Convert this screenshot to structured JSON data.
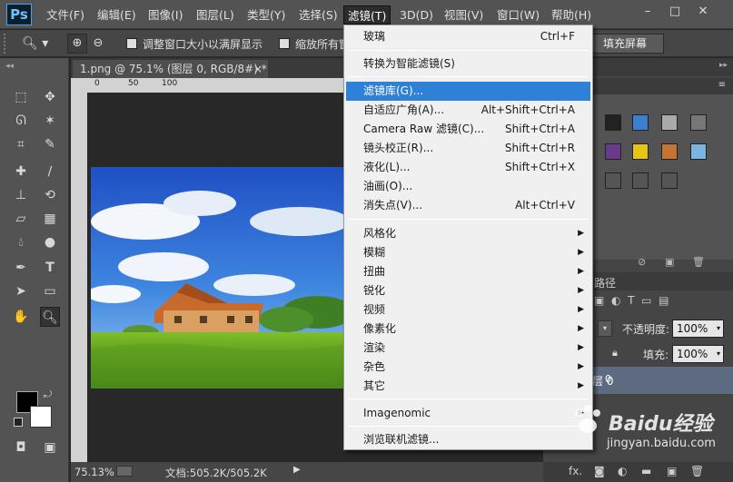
{
  "app": {
    "logo": "Ps"
  },
  "menubar": {
    "items": [
      "文件(F)",
      "编辑(E)",
      "图像(I)",
      "图层(L)",
      "类型(Y)",
      "选择(S)",
      "滤镜(T)",
      "3D(D)",
      "视图(V)",
      "窗口(W)",
      "帮助(H)"
    ],
    "active": "滤镜(T)",
    "window_buttons": {
      "minimize": "–",
      "restore": "□",
      "close": "✕"
    }
  },
  "options_bar": {
    "resize_windows_label": "调整窗口大小以满屏显示",
    "zoom_all_label": "缩放所有窗",
    "fill_screen_button": "填充屏幕"
  },
  "document": {
    "tab_title": "1.png @ 75.1% (图层 0, RGB/8#) *",
    "ruler_marks": [
      "0",
      "50",
      "100"
    ],
    "zoom": "75.13%",
    "doc_info": "文档:505.2K/505.2K"
  },
  "layers_panel": {
    "opacity_label": "不透明度:",
    "opacity_value": "100%",
    "fill_label": "填充:",
    "fill_value": "100%",
    "layer_name": "层 0",
    "layer_value": "0",
    "paths_tab": "路径"
  },
  "filter_menu": {
    "items": [
      {
        "label": "玻璃",
        "shortcut": "Ctrl+F"
      },
      {
        "label": "转换为智能滤镜(S)"
      },
      {
        "label": "滤镜库(G)...",
        "highlighted": true
      },
      {
        "label": "自适应广角(A)...",
        "shortcut": "Alt+Shift+Ctrl+A"
      },
      {
        "label": "Camera Raw 滤镜(C)...",
        "shortcut": "Shift+Ctrl+A"
      },
      {
        "label": "镜头校正(R)...",
        "shortcut": "Shift+Ctrl+R"
      },
      {
        "label": "液化(L)...",
        "shortcut": "Shift+Ctrl+X"
      },
      {
        "label": "油画(O)..."
      },
      {
        "label": "消失点(V)...",
        "shortcut": "Alt+Ctrl+V"
      },
      {
        "label": "风格化"
      },
      {
        "label": "模糊"
      },
      {
        "label": "扭曲"
      },
      {
        "label": "锐化"
      },
      {
        "label": "视频"
      },
      {
        "label": "像素化"
      },
      {
        "label": "渲染"
      },
      {
        "label": "杂色"
      },
      {
        "label": "其它"
      },
      {
        "label": "Imagenomic"
      },
      {
        "label": "浏览联机滤镜..."
      }
    ]
  },
  "watermark": {
    "brand": "Baidu经验",
    "url": "jingyan.baidu.com"
  },
  "colors": {
    "menu_highlight": "#2f80d7",
    "ui_dark": "#535353",
    "foreground": "#000000",
    "background": "#ffffff"
  }
}
